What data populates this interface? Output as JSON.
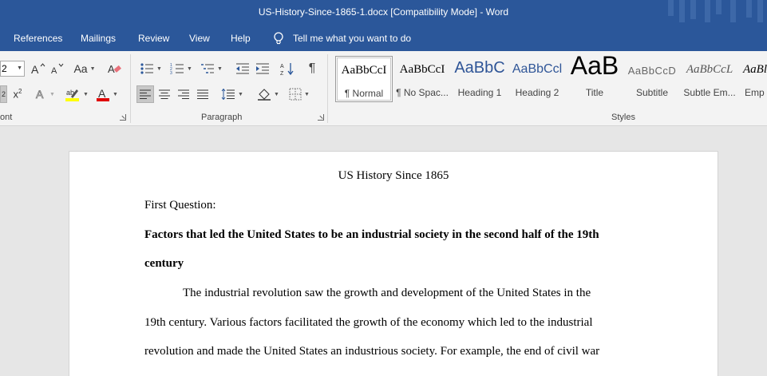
{
  "window": {
    "title": "US-History-Since-1865-1.docx [Compatibility Mode]  -  Word"
  },
  "tabs": [
    "References",
    "Mailings",
    "Review",
    "View",
    "Help"
  ],
  "tell_me": "Tell me what you want to do",
  "ribbon": {
    "font_size_value": "2",
    "change_case_label": "Aa",
    "groups": {
      "font": "ont",
      "paragraph": "Paragraph",
      "styles": "Styles"
    },
    "styles": [
      {
        "sample": "AaBbCcI",
        "name": "¶ Normal",
        "selected": true
      },
      {
        "sample": "AaBbCcI",
        "name": "¶ No Spac..."
      },
      {
        "sample": "AaBbC",
        "name": "Heading 1"
      },
      {
        "sample": "AaBbCcl",
        "name": "Heading 2"
      },
      {
        "sample": "AaB",
        "name": "Title"
      },
      {
        "sample": "AaBbCcD",
        "name": "Subtitle"
      },
      {
        "sample": "AaBbCcL",
        "name": "Subtle Em..."
      },
      {
        "sample": "AaBl",
        "name": "Emp"
      }
    ],
    "colors": {
      "highlight": "#ffff00",
      "font_color": "#e00000"
    }
  },
  "document": {
    "title": "US History Since 1865",
    "question_label": "First Question:",
    "heading_line1": "Factors that led the United States to be an industrial society in the second half of the 19th",
    "heading_line2": "century",
    "body_line1": "The industrial revolution saw the growth and development of the United States in the",
    "body_line2": "19th century. Various factors facilitated the growth of the economy which led to the industrial",
    "body_line3": "revolution and made the United States an industrious society. For example, the end of civil war"
  }
}
